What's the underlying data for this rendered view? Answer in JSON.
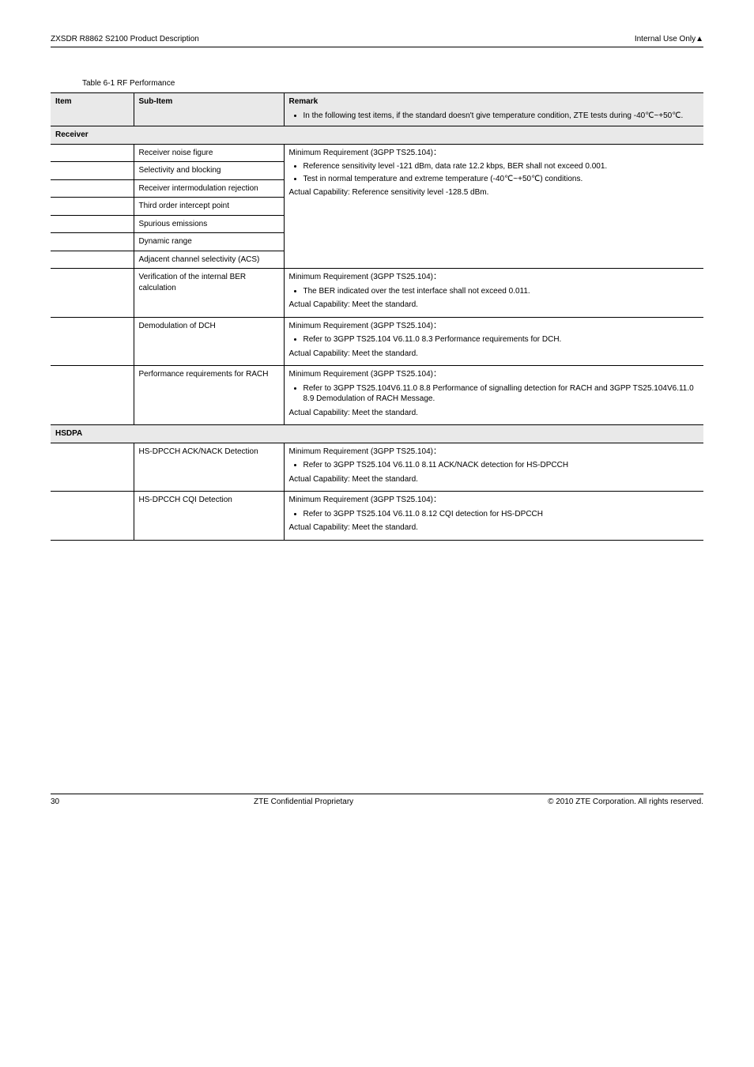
{
  "header": {
    "left": "ZXSDR R8862 S2100 Product Description",
    "right": "Internal Use Only▲"
  },
  "caption": "Table 6-1 RF Performance",
  "columns": [
    "Item",
    "Sub-Item",
    "Remark"
  ],
  "sections": [
    {
      "title": "Receiver",
      "rows": [
        {
          "item": "",
          "sub": "Receiver noise figure",
          "merged_remark": {
            "para1": "Minimum Requirement (3GPP TS25.104)：",
            "bullets": [
              "Reference sensitivity level -121 dBm, data rate 12.2 kbps, BER shall not exceed 0.001.",
              "Test in normal temperature and extreme temperature (-40℃~+50℃) conditions."
            ],
            "para2": "Actual Capability: Reference sensitivity level -128.5 dBm."
          }
        },
        {
          "item": "",
          "sub": "Selectivity and blocking"
        },
        {
          "item": "",
          "sub": "Receiver intermodulation rejection"
        },
        {
          "item": "",
          "sub": "Third order intercept point"
        },
        {
          "item": "",
          "sub": "Spurious emissions"
        },
        {
          "item": "",
          "sub": "Dynamic range"
        },
        {
          "item": "",
          "sub": "Adjacent channel selectivity (ACS)"
        },
        {
          "item": "",
          "sub": "Verification of the internal BER calculation",
          "own_remark": {
            "para1": "Minimum Requirement (3GPP TS25.104)：",
            "bullets": [
              "The BER indicated over the test interface shall not exceed 0.011."
            ],
            "para2": "Actual Capability: Meet the standard."
          }
        },
        {
          "item": "",
          "sub": "Demodulation of DCH",
          "own_remark": {
            "para1": "Minimum Requirement (3GPP TS25.104)：",
            "bullets": [
              "Refer to 3GPP TS25.104 V6.11.0 8.3 Performance requirements for DCH."
            ],
            "para2": "Actual Capability: Meet the standard."
          }
        },
        {
          "item": "",
          "sub": "Performance requirements for RACH",
          "own_remark": {
            "para1": "Minimum Requirement (3GPP TS25.104)：",
            "bullets": [
              "Refer to 3GPP TS25.104V6.11.0 8.8 Performance of signalling detection for RACH and 3GPP TS25.104V6.11.0 8.9 Demodulation of RACH Message."
            ],
            "para2": "Actual Capability: Meet the standard."
          }
        }
      ]
    },
    {
      "title": "HSDPA",
      "rows": [
        {
          "item": "",
          "sub": "HS-DPCCH ACK/NACK Detection",
          "own_remark": {
            "para1": "Minimum Requirement (3GPP TS25.104)：",
            "bullets": [
              "Refer to 3GPP TS25.104 V6.11.0 8.11 ACK/NACK detection for HS-DPCCH"
            ],
            "para2": "Actual Capability: Meet the standard."
          }
        },
        {
          "item": "",
          "sub": "HS-DPCCH CQI Detection",
          "own_remark": {
            "para1": "Minimum Requirement (3GPP TS25.104)：",
            "bullets": [
              "Refer to 3GPP TS25.104 V6.11.0 8.12 CQI detection for HS-DPCCH"
            ],
            "para2": "Actual Capability: Meet the standard."
          }
        }
      ]
    }
  ],
  "footer": {
    "left": "30",
    "center": "ZTE Confidential Proprietary",
    "right": "© 2010 ZTE Corporation. All rights reserved."
  }
}
